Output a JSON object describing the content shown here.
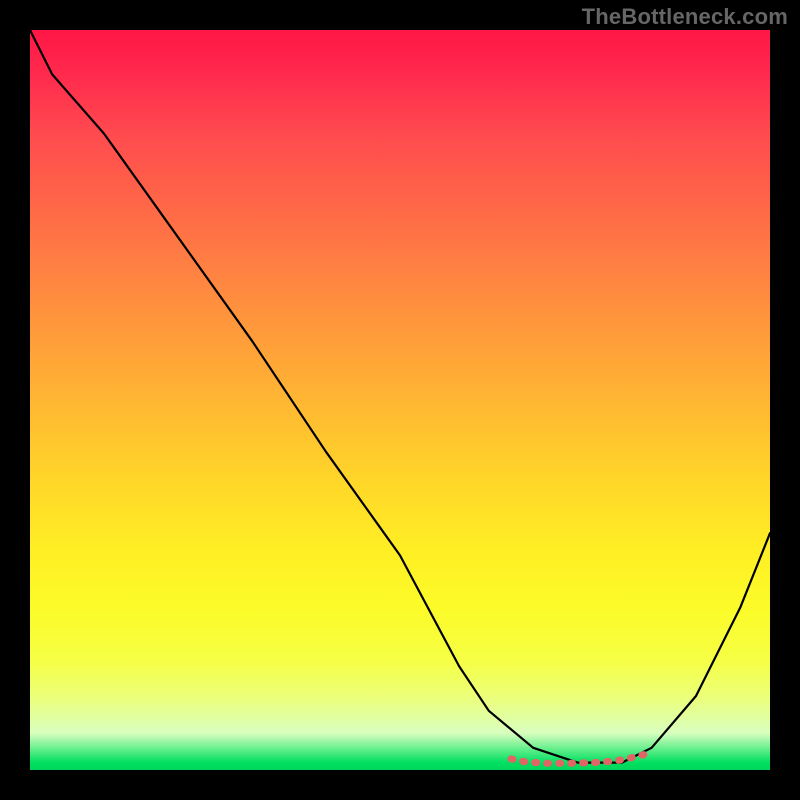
{
  "watermark": "TheBottleneck.com",
  "chart_data": {
    "type": "line",
    "title": "",
    "xlabel": "",
    "ylabel": "",
    "xlim": [
      0,
      100
    ],
    "ylim": [
      0,
      100
    ],
    "grid": false,
    "series": [
      {
        "name": "bottleneck-curve",
        "color": "#000000",
        "x": [
          0,
          3,
          10,
          20,
          30,
          40,
          50,
          58,
          62,
          68,
          74,
          80,
          84,
          90,
          96,
          100
        ],
        "y": [
          100,
          94,
          86,
          72,
          58,
          43,
          29,
          14,
          8,
          3,
          1,
          1,
          3,
          10,
          22,
          32
        ]
      },
      {
        "name": "recommended-range",
        "color": "#e57373",
        "x": [
          65,
          67,
          70,
          73,
          76,
          79,
          81,
          83
        ],
        "y": [
          1.5,
          1.1,
          0.9,
          0.9,
          1.0,
          1.2,
          1.6,
          2.1
        ]
      }
    ],
    "gradient_stops": [
      {
        "pos": 0.0,
        "color": "#ff1646"
      },
      {
        "pos": 0.5,
        "color": "#ffb030"
      },
      {
        "pos": 0.8,
        "color": "#fbfc28"
      },
      {
        "pos": 0.96,
        "color": "#d9ffbf"
      },
      {
        "pos": 1.0,
        "color": "#00d65a"
      }
    ]
  }
}
